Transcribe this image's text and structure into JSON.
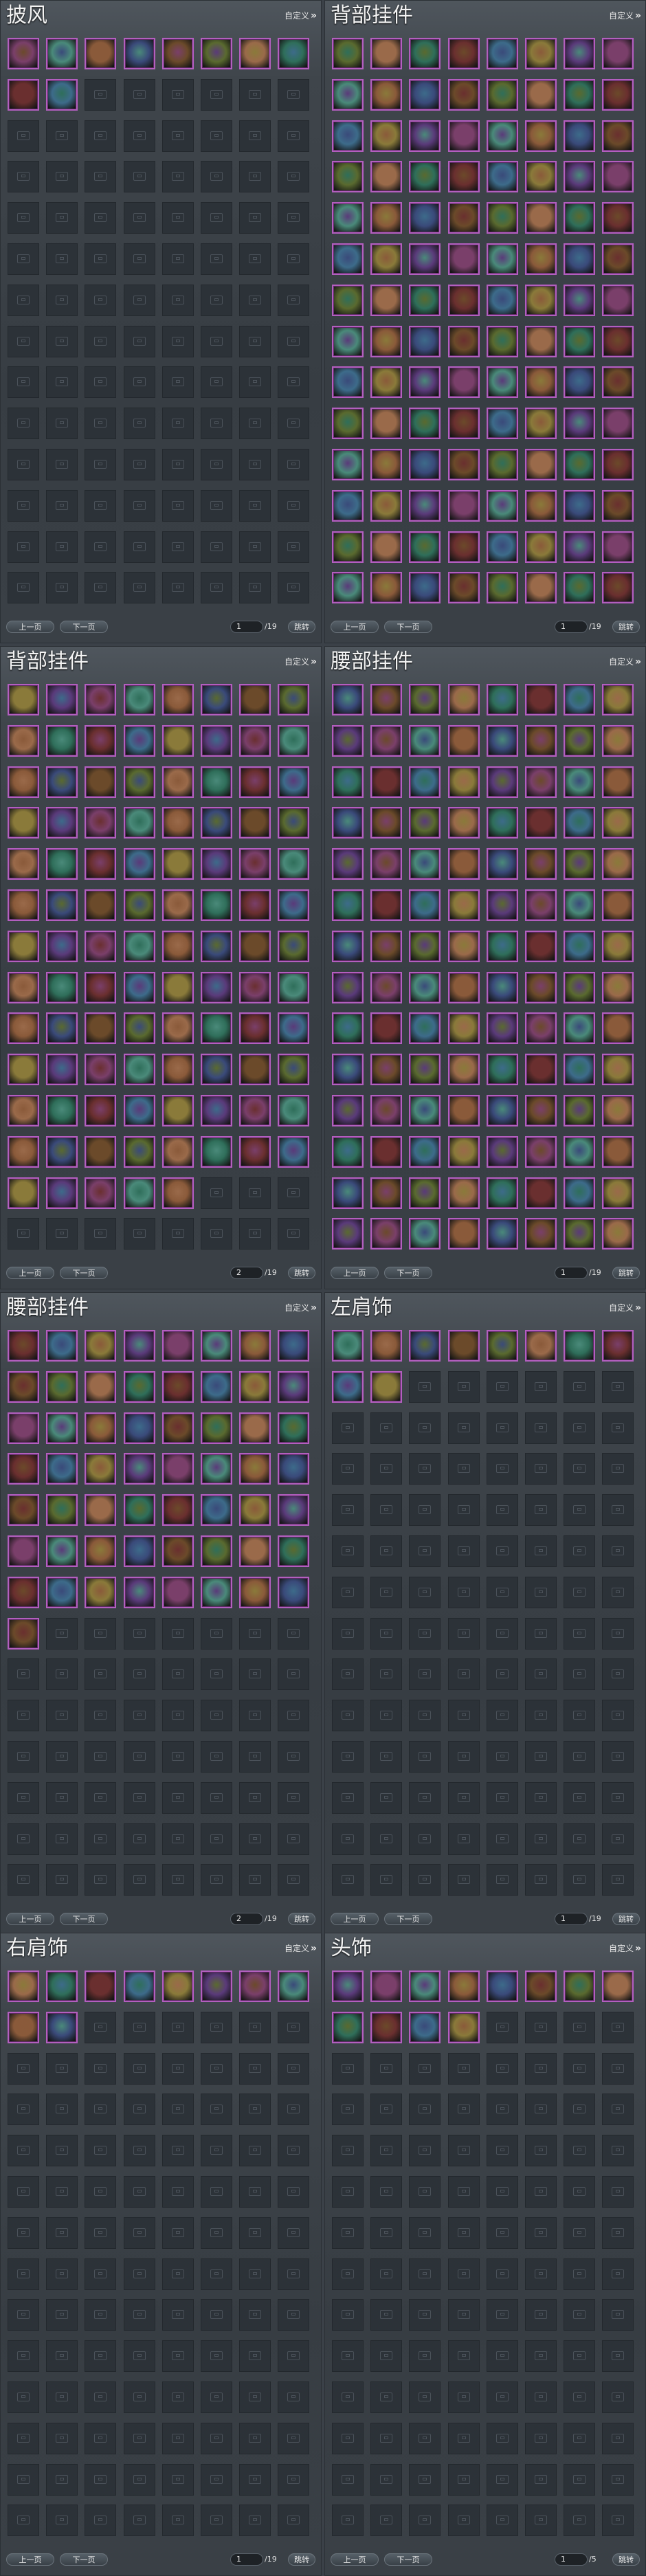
{
  "custom_label": "自定义",
  "chevron_glyph": "»",
  "prev_label": "上一页",
  "next_label": "下一页",
  "go_label": "跳转",
  "item_border_color": "#b35fbf",
  "panels": [
    {
      "title": "披风",
      "page": "1",
      "total": "/19",
      "filled": 10
    },
    {
      "title": "背部挂件",
      "page": "1",
      "total": "/19",
      "filled": 126
    },
    {
      "title": "背部挂件",
      "page": "2",
      "total": "/19",
      "filled": 101
    },
    {
      "title": "腰部挂件",
      "page": "1",
      "total": "/19",
      "filled": 126
    },
    {
      "title": "腰部挂件",
      "page": "2",
      "total": "/19",
      "filled": 57
    },
    {
      "title": "左肩饰",
      "page": "1",
      "total": "/19",
      "filled": 10
    },
    {
      "title": "右肩饰",
      "page": "1",
      "total": "/19",
      "filled": 10
    },
    {
      "title": "头饰",
      "page": "1",
      "total": "/5",
      "filled": 12
    }
  ]
}
